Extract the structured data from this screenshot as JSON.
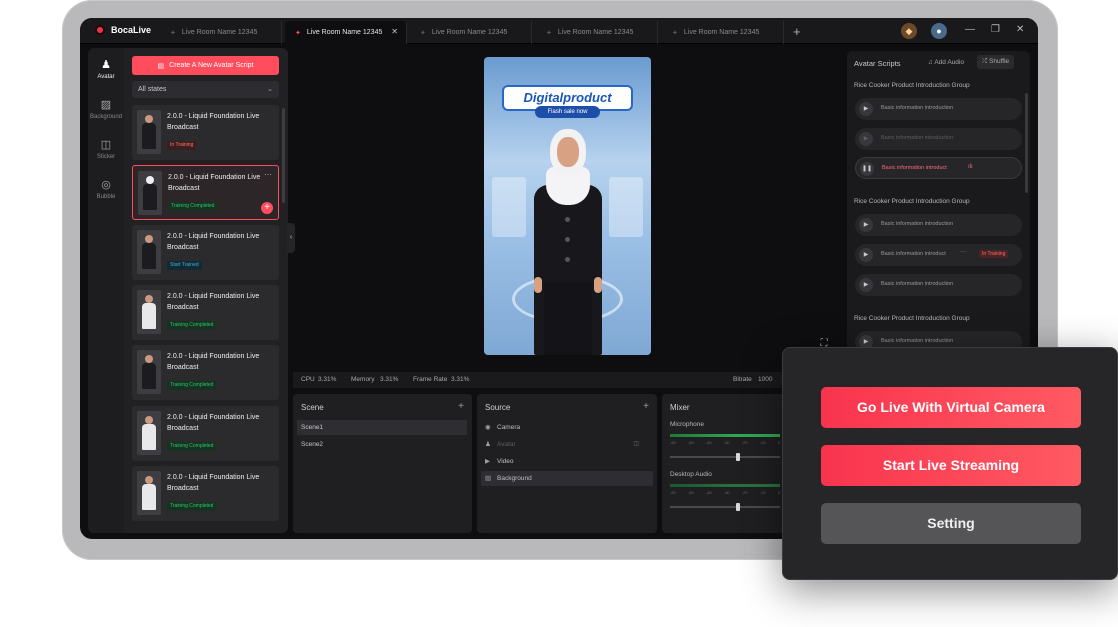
{
  "app": {
    "name": "BocaLive"
  },
  "tabs": [
    {
      "label": "Live Room Name 12345",
      "active": false
    },
    {
      "label": "Live Room Name 12345",
      "active": true
    },
    {
      "label": "Live Room Name 12345",
      "active": false
    },
    {
      "label": "Live Room Name 12345",
      "active": false
    },
    {
      "label": "Live Room Name 12345",
      "active": false
    }
  ],
  "tab_close": "✕",
  "tab_add": "+",
  "rail": [
    {
      "label": "Avatar",
      "icon": "person-icon"
    },
    {
      "label": "Background",
      "icon": "background-icon"
    },
    {
      "label": "Sticker",
      "icon": "sticker-icon"
    },
    {
      "label": "Bubble",
      "icon": "bubble-icon"
    }
  ],
  "avatar_list": {
    "create_label": "Create A New Avatar Script",
    "filter_value": "All states",
    "cards": [
      {
        "title": "2.0.0 - Liquid Foundation Live Broadcast",
        "status": "In Training",
        "kind": "train"
      },
      {
        "title": "2.0.0 - Liquid Foundation Live Broadcast",
        "status": "Training Completed",
        "kind": "done"
      },
      {
        "title": "2.0.0 - Liquid Foundation Live Broadcast",
        "status": "Start Trained",
        "kind": "start"
      },
      {
        "title": "2.0.0 - Liquid Foundation Live Broadcast",
        "status": "Training Completed",
        "kind": "done"
      },
      {
        "title": "2.0.0 - Liquid Foundation Live Broadcast",
        "status": "Training Completed",
        "kind": "done"
      },
      {
        "title": "2.0.0 - Liquid Foundation Live Broadcast",
        "status": "Training Completed",
        "kind": "done"
      },
      {
        "title": "2.0.0 - Liquid Foundation Live Broadcast",
        "status": "Training Completed",
        "kind": "done"
      }
    ]
  },
  "preview": {
    "title": "Digitalproduct",
    "subtitle": "Flash sale now"
  },
  "scripts": {
    "title": "Avatar Scripts",
    "add_audio": "Add Audio",
    "shuffle": "Shuffle",
    "group_label": "Rice Cooker Product Introduction Group",
    "item_label": "Basic information introduction",
    "item_label_short": "Basic information introduct",
    "in_training": "In Training"
  },
  "status": {
    "cpu_label": "CPU",
    "cpu_value": "3.31%",
    "memory_label": "Memory",
    "memory_value": "3.31%",
    "frame_label": "Frame Rate",
    "frame_value": "3.31%",
    "bitrate_label": "Bitrate",
    "bitrate_value": "1000"
  },
  "scene": {
    "title": "Scene",
    "items": [
      "Scene1",
      "Scene2"
    ]
  },
  "source": {
    "title": "Source",
    "items": [
      "Camera",
      "Avatar",
      "Video",
      "Background"
    ]
  },
  "mixer": {
    "title": "Mixer",
    "microphone": "Microphone",
    "desktop": "Desktop Audio",
    "ticks": [
      "-60",
      "-50",
      "-40",
      "-30",
      "-20",
      "-10",
      "0"
    ]
  },
  "actions": {
    "virtual_camera": "Go Live With Virtual Camera",
    "start_streaming": "Start Live Streaming",
    "setting": "Setting"
  },
  "colors": {
    "accent": "#ff4d5e",
    "bezel": "#b9b9bb",
    "screen": "#0e0e10"
  }
}
